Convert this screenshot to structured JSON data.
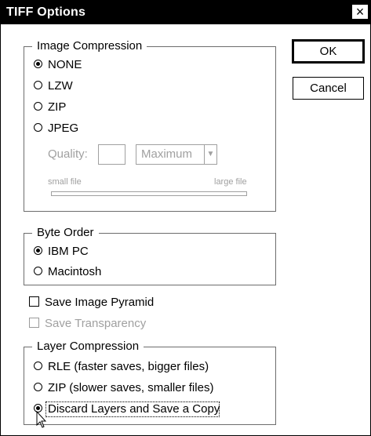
{
  "window": {
    "title": "TIFF Options",
    "close_glyph": "×"
  },
  "buttons": {
    "ok": "OK",
    "cancel": "Cancel"
  },
  "image_compression": {
    "legend": "Image Compression",
    "options": [
      "NONE",
      "LZW",
      "ZIP",
      "JPEG"
    ],
    "selected": "NONE",
    "quality_label": "Quality:",
    "quality_value": "",
    "quality_preset": "Maximum",
    "small_file": "small file",
    "large_file": "large file"
  },
  "byte_order": {
    "legend": "Byte Order",
    "options": [
      "IBM PC",
      "Macintosh"
    ],
    "selected": "IBM PC"
  },
  "checkboxes": {
    "save_image_pyramid": {
      "label": "Save Image Pyramid",
      "checked": false,
      "enabled": true
    },
    "save_transparency": {
      "label": "Save Transparency",
      "checked": false,
      "enabled": false
    }
  },
  "layer_compression": {
    "legend": "Layer Compression",
    "options": [
      "RLE (faster saves, bigger files)",
      "ZIP (slower saves, smaller files)",
      "Discard Layers and Save a Copy"
    ],
    "selected": "Discard Layers and Save a Copy"
  },
  "icons": {
    "close": "close-icon",
    "dropdown": "chevron-down-icon",
    "pointer": "mouse-pointer-icon"
  },
  "colors": {
    "titlebar": "#000000",
    "disabled": "#a0a0a0",
    "frame": "#6d6d6d"
  }
}
